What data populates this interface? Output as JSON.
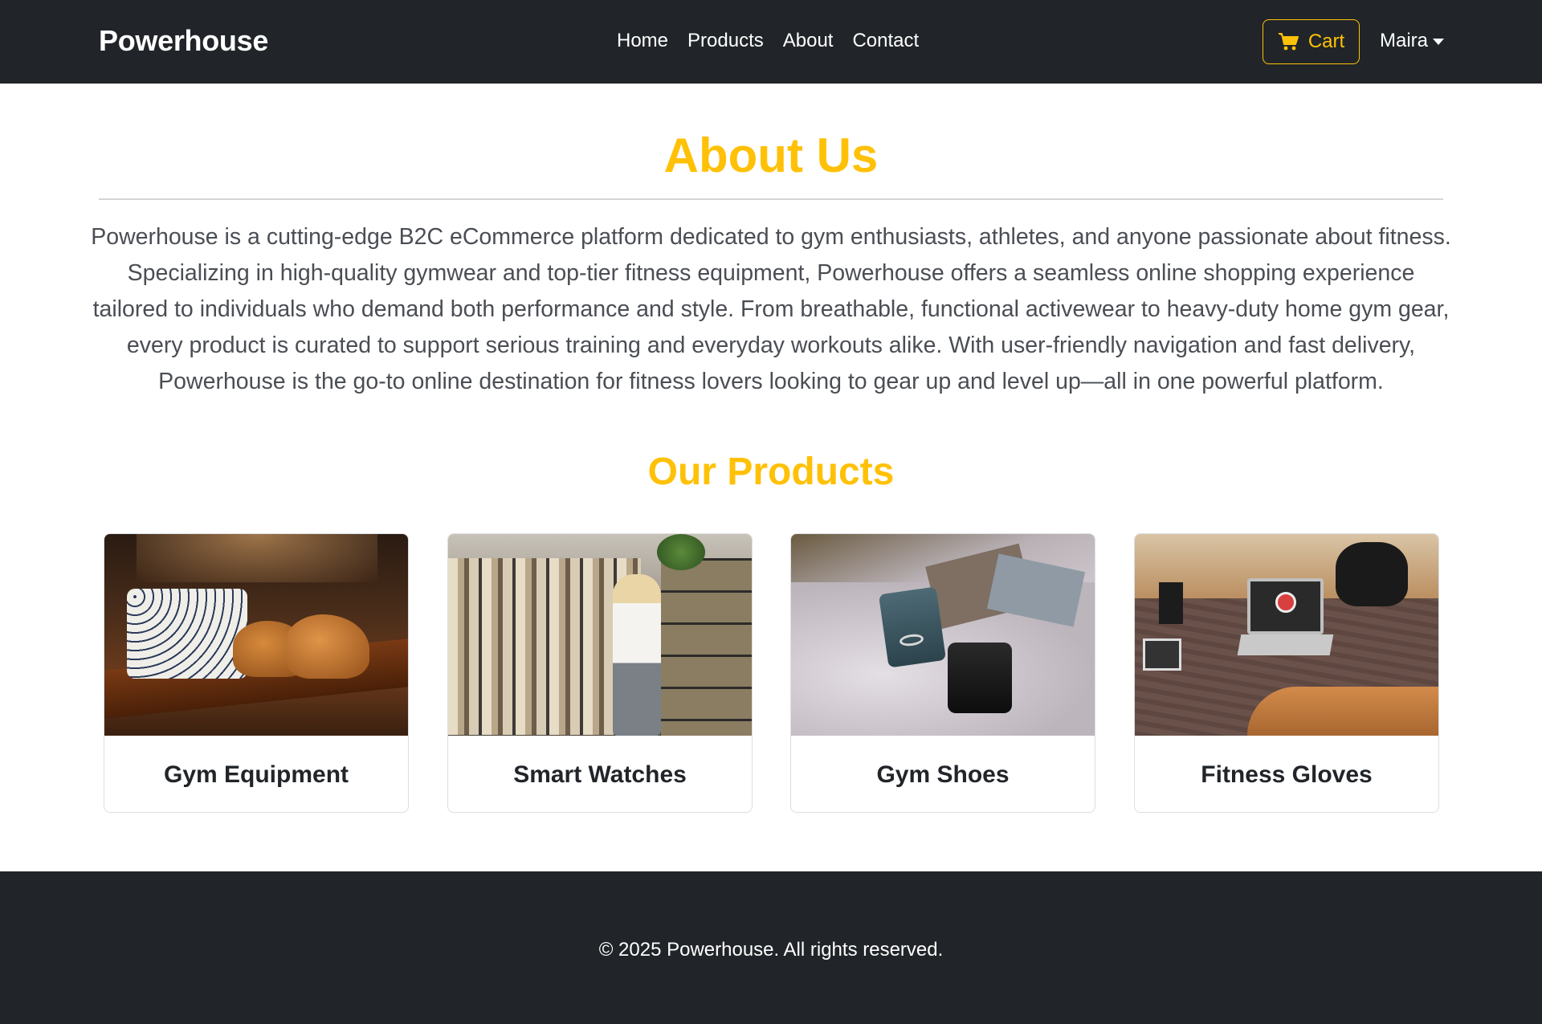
{
  "brand": "Powerhouse",
  "nav": {
    "links": [
      "Home",
      "Products",
      "About",
      "Contact"
    ],
    "cart_label": "Cart",
    "user_name": "Maira"
  },
  "about": {
    "title": "About Us",
    "text": "Powerhouse is a cutting-edge B2C eCommerce platform dedicated to gym enthusiasts, athletes, and anyone passionate about fitness. Specializing in high-quality gymwear and top-tier fitness equipment, Powerhouse offers a seamless online shopping experience tailored to individuals who demand both performance and style. From breathable, functional activewear to heavy-duty home gym gear, every product is curated to support serious training and everyday workouts alike. With user-friendly navigation and fast delivery, Powerhouse is the go-to online destination for fitness lovers looking to gear up and level up—all in one powerful platform."
  },
  "products": {
    "title": "Our Products",
    "items": [
      {
        "title": "Gym Equipment"
      },
      {
        "title": "Smart Watches"
      },
      {
        "title": "Gym Shoes"
      },
      {
        "title": "Fitness Gloves"
      }
    ]
  },
  "footer": {
    "copyright": "© 2025 Powerhouse. All rights reserved."
  },
  "colors": {
    "accent": "#ffc107",
    "dark": "#212529",
    "text_muted": "#4a4e54"
  }
}
